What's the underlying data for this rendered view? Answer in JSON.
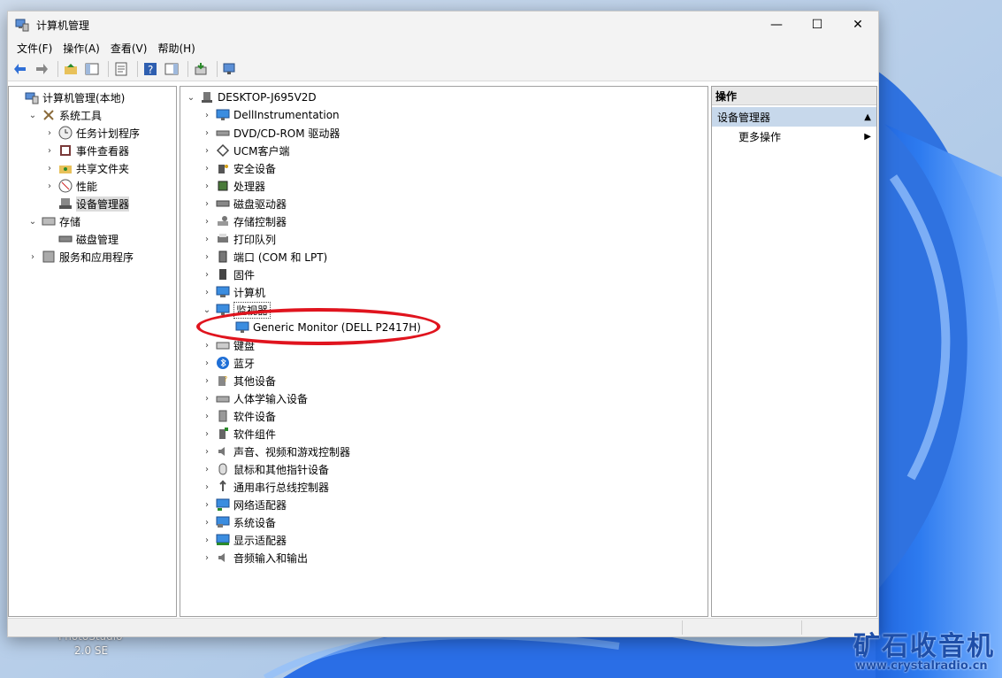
{
  "window": {
    "title": "计算机管理"
  },
  "menu": [
    "文件(F)",
    "操作(A)",
    "查看(V)",
    "帮助(H)"
  ],
  "left_tree": [
    {
      "label": "计算机管理(本地)",
      "level": 0,
      "chevron": "",
      "icon": "computer-manage-icon"
    },
    {
      "label": "系统工具",
      "level": 1,
      "chevron": "v",
      "icon": "tools-icon"
    },
    {
      "label": "任务计划程序",
      "level": 2,
      "chevron": ">",
      "icon": "clock-icon"
    },
    {
      "label": "事件查看器",
      "level": 2,
      "chevron": ">",
      "icon": "event-viewer-icon"
    },
    {
      "label": "共享文件夹",
      "level": 2,
      "chevron": ">",
      "icon": "shared-folder-icon"
    },
    {
      "label": "性能",
      "level": 2,
      "chevron": ">",
      "icon": "performance-icon"
    },
    {
      "label": "设备管理器",
      "level": 2,
      "chevron": "",
      "icon": "device-manager-icon",
      "selected": true
    },
    {
      "label": "存储",
      "level": 1,
      "chevron": "v",
      "icon": "storage-icon"
    },
    {
      "label": "磁盘管理",
      "level": 2,
      "chevron": "",
      "icon": "disk-icon"
    },
    {
      "label": "服务和应用程序",
      "level": 1,
      "chevron": ">",
      "icon": "services-icon"
    }
  ],
  "device_tree": {
    "root": "DESKTOP-J695V2D",
    "items": [
      {
        "label": "DellInstrumentation",
        "chevron": ">",
        "icon": "monitor-icon"
      },
      {
        "label": "DVD/CD-ROM 驱动器",
        "chevron": ">",
        "icon": "dvd-icon"
      },
      {
        "label": "UCM客户端",
        "chevron": ">",
        "icon": "ucm-icon"
      },
      {
        "label": "安全设备",
        "chevron": ">",
        "icon": "security-icon"
      },
      {
        "label": "处理器",
        "chevron": ">",
        "icon": "processor-icon"
      },
      {
        "label": "磁盘驱动器",
        "chevron": ">",
        "icon": "disk-drive-icon"
      },
      {
        "label": "存储控制器",
        "chevron": ">",
        "icon": "storage-controller-icon"
      },
      {
        "label": "打印队列",
        "chevron": ">",
        "icon": "printer-icon"
      },
      {
        "label": "端口 (COM 和 LPT)",
        "chevron": ">",
        "icon": "port-icon"
      },
      {
        "label": "固件",
        "chevron": ">",
        "icon": "firmware-icon"
      },
      {
        "label": "计算机",
        "chevron": ">",
        "icon": "computer-icon"
      },
      {
        "label": "监视器",
        "chevron": "v",
        "icon": "monitor-icon",
        "boxed": true
      },
      {
        "label": "Generic Monitor (DELL P2417H)",
        "chevron": "",
        "icon": "monitor-icon",
        "child": true
      },
      {
        "label": "键盘",
        "chevron": ">",
        "icon": "keyboard-icon"
      },
      {
        "label": "蓝牙",
        "chevron": ">",
        "icon": "bluetooth-icon"
      },
      {
        "label": "其他设备",
        "chevron": ">",
        "icon": "other-device-icon"
      },
      {
        "label": "人体学输入设备",
        "chevron": ">",
        "icon": "hid-icon"
      },
      {
        "label": "软件设备",
        "chevron": ">",
        "icon": "software-device-icon"
      },
      {
        "label": "软件组件",
        "chevron": ">",
        "icon": "software-component-icon"
      },
      {
        "label": "声音、视频和游戏控制器",
        "chevron": ">",
        "icon": "sound-icon"
      },
      {
        "label": "鼠标和其他指针设备",
        "chevron": ">",
        "icon": "mouse-icon"
      },
      {
        "label": "通用串行总线控制器",
        "chevron": ">",
        "icon": "usb-icon"
      },
      {
        "label": "网络适配器",
        "chevron": ">",
        "icon": "network-icon"
      },
      {
        "label": "系统设备",
        "chevron": ">",
        "icon": "system-device-icon"
      },
      {
        "label": "显示适配器",
        "chevron": ">",
        "icon": "display-adapter-icon"
      },
      {
        "label": "音频输入和输出",
        "chevron": ">",
        "icon": "audio-icon"
      }
    ]
  },
  "actions": {
    "header": "操作",
    "section": "设备管理器",
    "more": "更多操作"
  },
  "desktop": {
    "label_bottom_left_1": "PhotoStudio",
    "label_bottom_left_2": "2.0 SE",
    "brand_title": "矿石收音机",
    "brand_url": "www.crystalradio.cn"
  },
  "colors": {
    "highlight_ring": "#e0141e",
    "selection": "#c7d8eb",
    "brand": "#1e4ea8"
  }
}
